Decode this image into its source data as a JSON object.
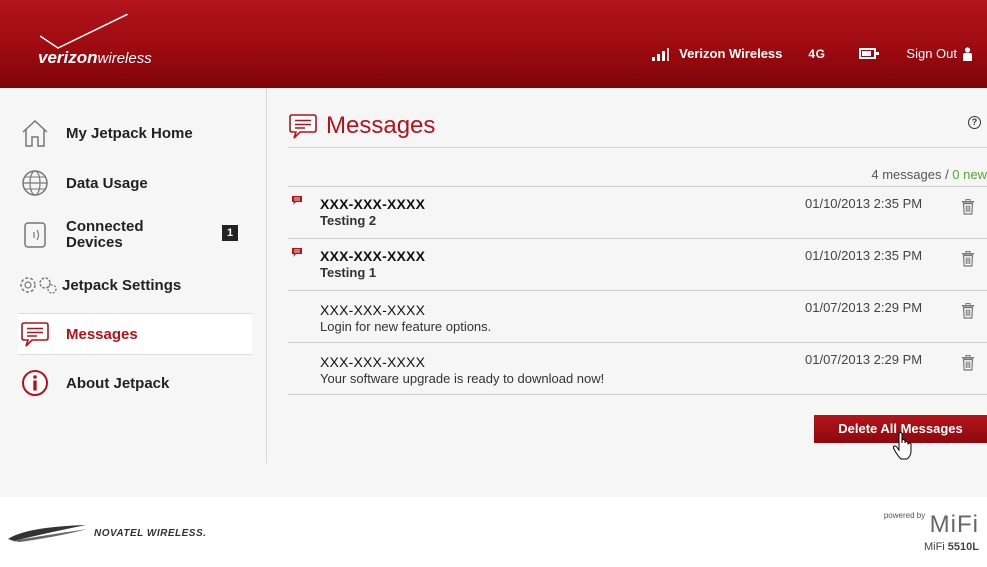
{
  "header": {
    "brand_main": "verizon",
    "brand_sub": "wireless",
    "carrier": "Verizon Wireless",
    "network": "4G",
    "sign_out": "Sign Out"
  },
  "sidebar": {
    "items": [
      {
        "label": "My Jetpack Home",
        "icon": "home-icon"
      },
      {
        "label": "Data Usage",
        "icon": "globe-icon"
      },
      {
        "label": "Connected Devices",
        "icon": "device-icon",
        "badge": "1"
      },
      {
        "label": "Jetpack Settings",
        "icon": "gears-icon"
      },
      {
        "label": "Messages",
        "icon": "message-icon",
        "active": true
      },
      {
        "label": "About Jetpack",
        "icon": "info-icon"
      }
    ]
  },
  "main": {
    "title": "Messages",
    "count_total": "4 messages",
    "count_sep": " / ",
    "count_new": "0 new",
    "messages": [
      {
        "sender": "XXX-XXX-XXXX",
        "subject": "Testing 2",
        "date": "01/10/2013 2:35 PM",
        "unread": true
      },
      {
        "sender": "XXX-XXX-XXXX",
        "subject": "Testing 1",
        "date": "01/10/2013 2:35 PM",
        "unread": true
      },
      {
        "sender": "XXX-XXX-XXXX",
        "subject": "Login for new feature options.",
        "date": "01/07/2013 2:29 PM",
        "unread": false
      },
      {
        "sender": "XXX-XXX-XXXX",
        "subject": "Your software upgrade is ready to download now!",
        "date": "01/07/2013 2:29 PM",
        "unread": false
      }
    ],
    "delete_all": "Delete All Messages"
  },
  "footer": {
    "novatel": "NOVATEL WIRELESS.",
    "powered_by": "powered by",
    "mifi": "MiFi",
    "model_prefix": "MiFi ",
    "model_number": "5510L"
  },
  "colors": {
    "brand_red": "#b2141b",
    "new_green": "#54a537"
  }
}
